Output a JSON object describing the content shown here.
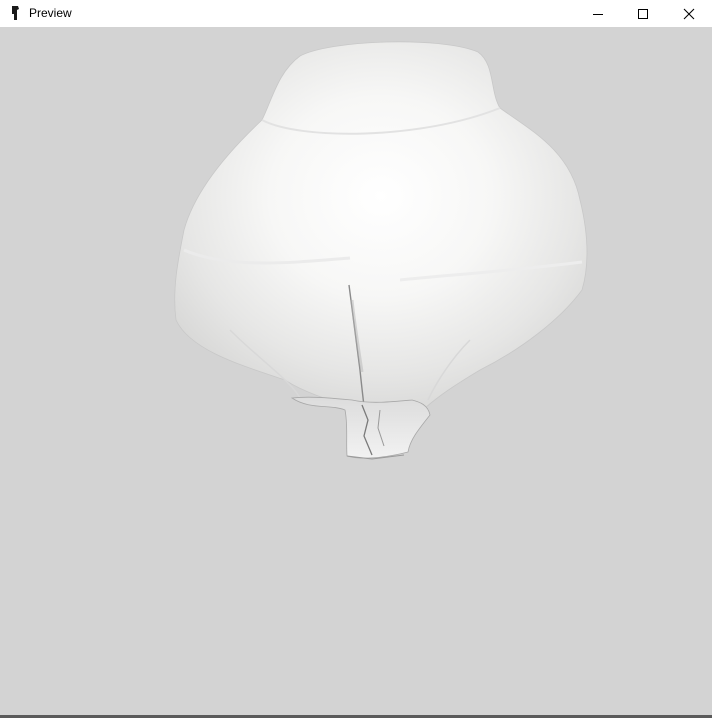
{
  "window": {
    "title": "Preview",
    "icon": "app-figure-icon",
    "controls": {
      "minimize_icon": "minimize-icon",
      "maximize_icon": "maximize-icon",
      "close_icon": "close-icon"
    }
  },
  "viewport": {
    "background_color": "#d3d3d3",
    "model": "3d-cloth-mesh"
  }
}
